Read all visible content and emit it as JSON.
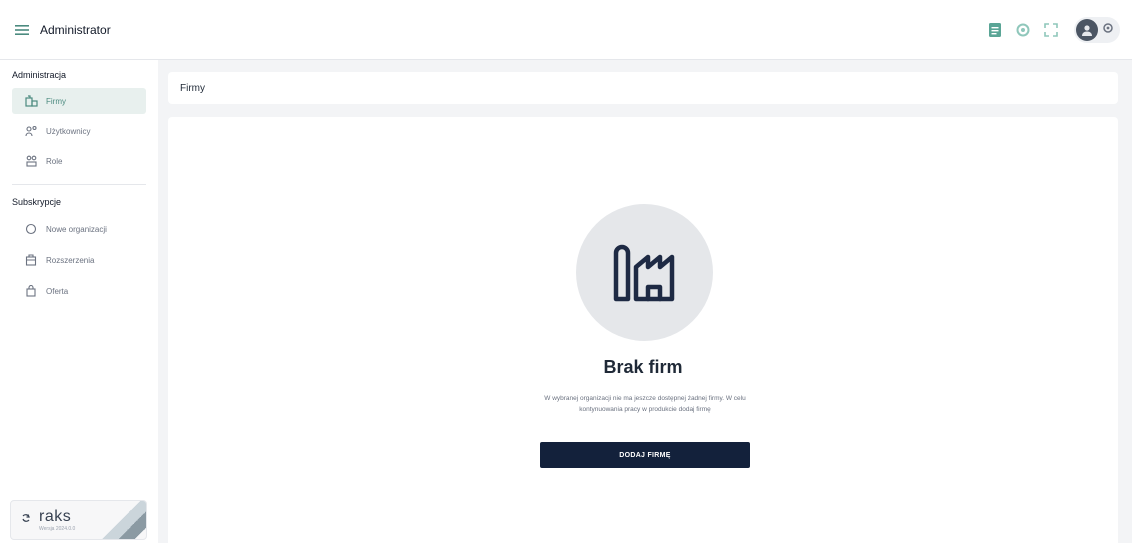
{
  "app": {
    "title": "Administrator"
  },
  "sidebar": {
    "sections": [
      {
        "label": "Administracja",
        "items": [
          {
            "label": "Firmy",
            "icon": "buildings-icon"
          },
          {
            "label": "Użytkownicy",
            "icon": "users-icon"
          },
          {
            "label": "Role",
            "icon": "roles-icon"
          }
        ]
      },
      {
        "label": "Subskrypcje",
        "items": [
          {
            "label": "Nowe organizacji",
            "icon": "circle-icon"
          },
          {
            "label": "Rozszerzenia",
            "icon": "package-icon"
          },
          {
            "label": "Oferta",
            "icon": "bag-icon"
          }
        ]
      }
    ],
    "brand": {
      "name": "raks",
      "sub": "Wersja 2024.0.0"
    }
  },
  "main": {
    "page_title": "Firmy",
    "empty_state": {
      "title": "Brak firm",
      "description": "W wybranej organizacji nie ma jeszcze dostępnej żadnej firmy. W celu kontynuowania pracy w produkcie dodaj firmę",
      "button_label": "DODAJ FIRMĘ"
    }
  },
  "colors": {
    "primary_dark": "#13213b",
    "accent_green": "#4b8a7f",
    "active_bg": "#e8f0ee"
  }
}
